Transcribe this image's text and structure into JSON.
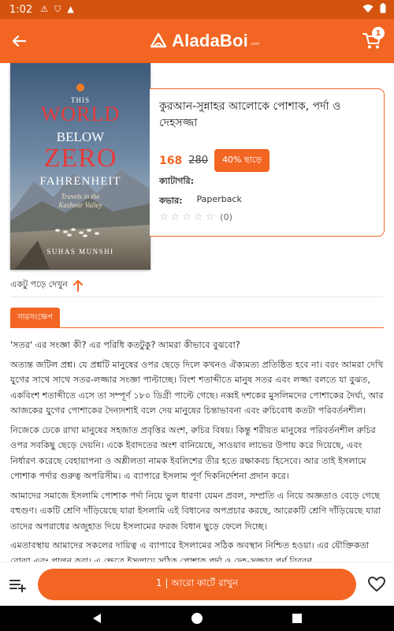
{
  "statusbar": {
    "time": "1:02",
    "notif_icons": [
      "warning-icon",
      "shield-icon",
      "triangle-icon"
    ],
    "status_icons": [
      "wifi-icon",
      "battery-icon"
    ]
  },
  "appbar": {
    "logo_text": "AladaBoi",
    "logo_suffix": ".com",
    "cart_count": "1"
  },
  "book": {
    "cover": {
      "line1": "THIS",
      "line2": "WORLD",
      "line3": "BELOW",
      "line4": "ZERO",
      "line5": "FAHRENHEIT",
      "subtitle1": "Travels in the",
      "subtitle2": "Kashmir Valley",
      "author": "SUHAS MUNSHI"
    },
    "title": "কুরআন-সুন্নাহর আলোকে পোশাক, পর্দা ও দেহসজ্জা",
    "price_new": "168",
    "price_old": "280",
    "discount": "40% ছাড়ে",
    "category_label": "ক্যাটাগরি:",
    "cover_label": "কভার:",
    "cover_value": "Paperback",
    "rating_count": "(0)"
  },
  "peek_label": "একটু পড়ে দেখুন",
  "section_tab": "সারসংক্ষেপ",
  "summary": {
    "p1": "'সতর' এর সংজ্ঞা কী? এর পরিধি কতটুকু? আমরা কীভাবে বুঝবো?",
    "p2": "অত্যন্ত জটিল প্রশ্ন। যে প্রশ্নটি মানুষের ওপর ছেড়ে দিলে কখনও ঐক্যমত্য প্রতিষ্ঠিত হবে না। বরং আমরা দেখি যুগের সাথে সাথে সতর-লজ্জার সংজ্ঞা পাল্টাচ্ছে। বিংশ শতাব্দীতে মানুষ সতর এবং লজ্জা বলতে যা বুঝত, একবিংশ শতাব্দীতে এসে তা সম্পূর্ণ ১৮০ ডিগ্রী পাল্টে গেছে। নব্বই দশকের মুসলিমদের পোশাকের দৈর্ঘ্য, আর আজকের যুগের পোশাকের দৈন্যদশাই বলে দেয় মানুষের চিন্তাভাবনা এবং রুচিবোধ কতটা পরিবর্তনশীল।",
    "p3": "নিজেকে ঢেকে রাখা মানুষের সহজাত প্রবৃত্তির অংশ, রুচির বিষয়। কিন্তু শরীয়ত মানুষের পরিবর্তনশীল রুচির ওপর সবকিছু ছেড়ে দেয়নি। একে ইবাদতের অংশ বানিয়েছে, সাওয়াব লাভের উপায় করে দিয়েছে, এবং নির্ধারণ করেছে বেহায়াপনা ও অশ্লীলতা নামক ইবলিশের তীর হতে রক্ষাকবচ হিসেবে। আর তাই ইসলামে পোশাক পর্দার গুরুত্ব অপরিসীম। এ ব্যাপারে ইসলাম পূর্ণ দিকনির্দেশনা প্রদান করে।",
    "p4": "আমাদের সমাজে ইসলামি পোশাক পর্দা নিয়ে ভুল ধারণা যেমন প্রবল, সম্প্রতি এ নিয়ে অজ্ঞতাও বেড়ে গেছে বহুগুণ। একটি শ্রেণি দাঁড়িয়েছে যারা ইসলামি এই বিধানের অপপ্রচার করছে, আরেকটি শ্রেণি দাঁড়িয়েছে যারা তাদের অপরাধের অজুহাত দিয়ে ইসলামের ফরজ বিধান ছুড়ে ফেলে দিচ্ছে।",
    "p5": "এমতাবস্থায় আমাদের সকলের দায়িত্ব এ ব্যাপারে ইসলামের সঠিক অবস্থান নিশ্চিত হওয়া। এর যৌক্তিকতা বোঝা এবং পালন করা। এ ক্ষেত্রে ইসলামে সঠিক পোশাক পর্দা ও দেহ-সজ্জার পূর্ণ বিবরণ"
  },
  "bottombar": {
    "cta_label": "1 | আরো কার্টে রাখুন"
  },
  "colors": {
    "accent": "#f26522",
    "statusbar": "#d4530f"
  }
}
